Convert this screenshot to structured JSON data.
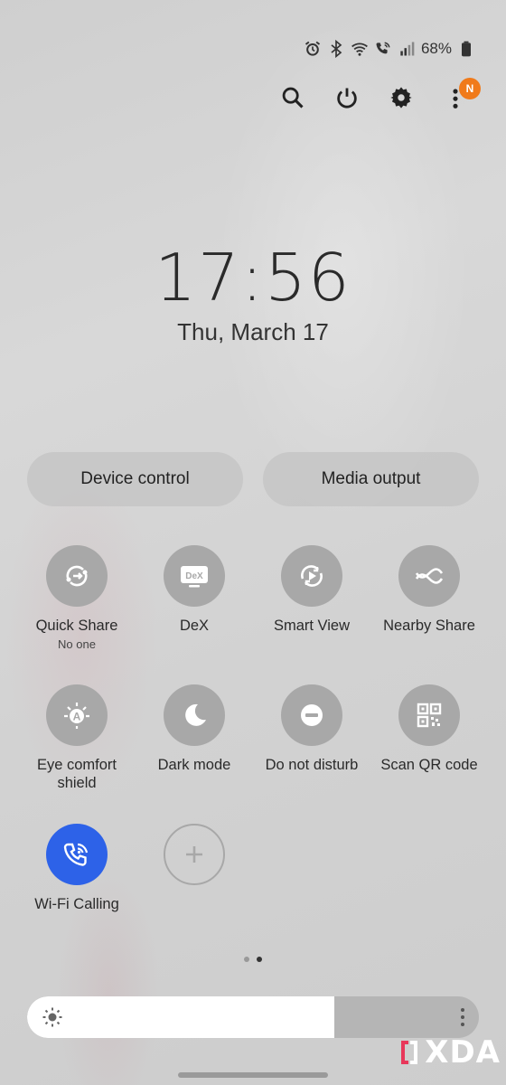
{
  "status_bar": {
    "icons": [
      "alarm-icon",
      "bluetooth-icon",
      "wifi-icon",
      "wifi-calling-icon",
      "signal-icon",
      "battery-icon"
    ],
    "battery_percent": "68%"
  },
  "top_actions": {
    "icons": [
      "search-icon",
      "power-icon",
      "settings-icon",
      "more-icon"
    ],
    "notification_badge": "N"
  },
  "clock": {
    "time": "17:56",
    "date": "Thu, March 17"
  },
  "pills": {
    "device_control": "Device control",
    "media_output": "Media output"
  },
  "tiles": [
    {
      "label": "Quick Share",
      "sub": "No one",
      "icon": "quick-share-icon",
      "active": false
    },
    {
      "label": "DeX",
      "sub": "",
      "icon": "dex-icon",
      "active": false
    },
    {
      "label": "Smart View",
      "sub": "",
      "icon": "smart-view-icon",
      "active": false
    },
    {
      "label": "Nearby Share",
      "sub": "",
      "icon": "nearby-share-icon",
      "active": false
    },
    {
      "label": "Eye comfort shield",
      "sub": "",
      "icon": "eye-comfort-icon",
      "active": false
    },
    {
      "label": "Dark mode",
      "sub": "",
      "icon": "moon-icon",
      "active": false
    },
    {
      "label": "Do not disturb",
      "sub": "",
      "icon": "do-not-disturb-icon",
      "active": false
    },
    {
      "label": "Scan QR code",
      "sub": "",
      "icon": "qr-code-icon",
      "active": false
    },
    {
      "label": "Wi-Fi Calling",
      "sub": "",
      "icon": "wifi-calling-icon",
      "active": true
    }
  ],
  "dex_icon_text": "DeX",
  "pager": {
    "pages": 2,
    "current": 2
  },
  "brightness": {
    "level": 0.68
  },
  "watermark": "XDA",
  "colors": {
    "active_tile": "#2d62e8",
    "badge": "#f07a1a",
    "tile": "#a8a8a8"
  }
}
